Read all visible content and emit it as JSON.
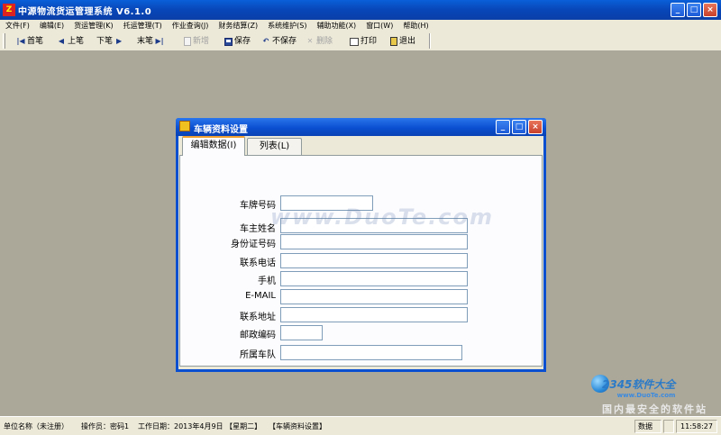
{
  "app": {
    "icon_glyph": "Z",
    "title": "中源物流货运管理系统 V6.1.0"
  },
  "window_buttons": {
    "min": "_",
    "max": "□",
    "close": "×"
  },
  "menu": [
    "文件(F)",
    "编辑(E)",
    "货运管理(K)",
    "托运管理(T)",
    "作业查询(J)",
    "财务结算(Z)",
    "系统维护(S)",
    "辅助功能(X)",
    "窗口(W)",
    "帮助(H)"
  ],
  "toolbar": {
    "first": {
      "icon": "|◀",
      "label": "首笔"
    },
    "prev": {
      "icon": "◀",
      "label": "上笔"
    },
    "next": {
      "icon": "▶",
      "label": "下笔"
    },
    "last": {
      "icon": "▶|",
      "label": "末笔"
    },
    "new": {
      "label": "新增"
    },
    "save": {
      "label": "保存"
    },
    "nosave": {
      "icon": "↶",
      "label": "不保存"
    },
    "delete": {
      "icon": "✕",
      "label": "删除"
    },
    "print": {
      "label": "打印"
    },
    "exit": {
      "label": "退出"
    }
  },
  "child": {
    "title": "车辆资料设置",
    "tabs": [
      "编辑数据(I)",
      "列表(L)"
    ],
    "fields": [
      {
        "label": "车牌号码",
        "value": ""
      },
      {
        "label": "车主姓名",
        "value": ""
      },
      {
        "label": "身份证号码",
        "value": ""
      },
      {
        "label": "联系电话",
        "value": ""
      },
      {
        "label": "手机",
        "value": ""
      },
      {
        "label": "E-MAIL",
        "value": ""
      },
      {
        "label": "联系地址",
        "value": ""
      },
      {
        "label": "邮政编码",
        "value": ""
      },
      {
        "label": "所属车队",
        "value": ""
      }
    ]
  },
  "watermark": {
    "text": "www.DuoTe.com",
    "logo": "2345软件大全",
    "logo_url": "www.DuoTe.com",
    "slogan": "国内最安全的软件站"
  },
  "status": {
    "unit": "单位名称（未注册）",
    "operator": "操作员：密码1",
    "workdate": "工作日期：2013年4月9日 【星期二】",
    "module": "【车辆资料设置】",
    "mode": "数据",
    "time": "11:58:27"
  }
}
